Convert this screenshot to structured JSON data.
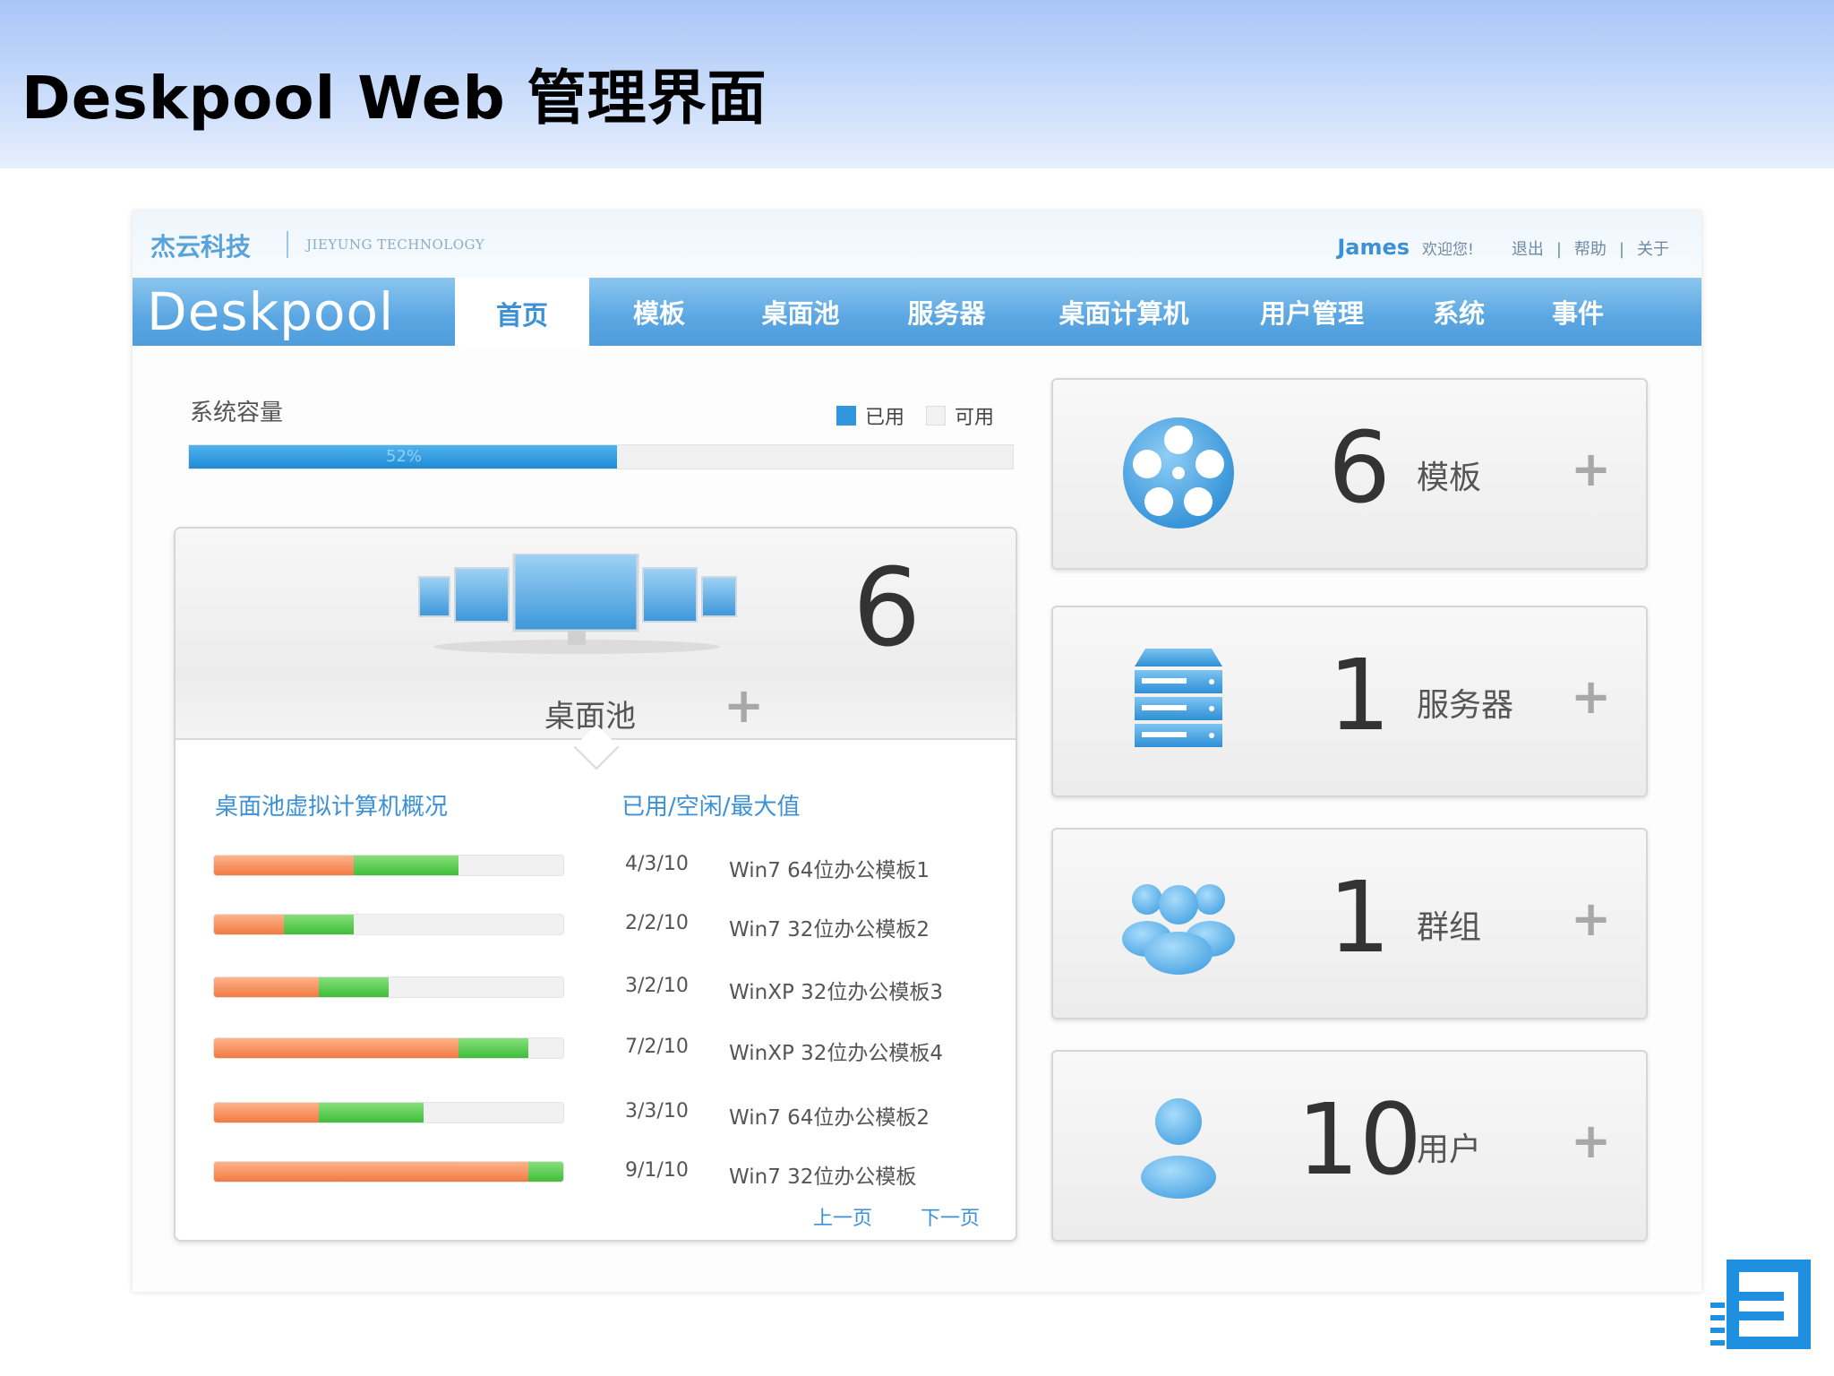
{
  "slide": {
    "title": "Deskpool Web 管理界面"
  },
  "app": {
    "company_cn": "杰云科技",
    "company_en": "JIEYUNG TECHNOLOGY",
    "user": {
      "name": "James",
      "welcome": "欢迎您!",
      "logout": "退出",
      "sep": "|",
      "help": "帮助",
      "about": "关于"
    },
    "brand": "Deskpool",
    "nav": [
      "首页",
      "模板",
      "桌面池",
      "服务器",
      "桌面计算机",
      "用户管理",
      "系统",
      "事件"
    ],
    "active_nav": 0
  },
  "capacity": {
    "label": "系统容量",
    "legend_used": "已用",
    "legend_free": "可用",
    "used_percent": 52,
    "used_text": "52%"
  },
  "pool": {
    "count": "6",
    "name": "桌面池",
    "plus": "+",
    "list_title": "桌面池虚拟计算机概况",
    "list_ratio_title": "已用/空闲/最大值",
    "rows": [
      {
        "ratio": "4/3/10",
        "template": "Win7 64位办公模板1",
        "used": 4,
        "idle": 3,
        "max": 10
      },
      {
        "ratio": "2/2/10",
        "template": "Win7 32位办公模板2",
        "used": 2,
        "idle": 2,
        "max": 10
      },
      {
        "ratio": "3/2/10",
        "template": "WinXP 32位办公模板3",
        "used": 3,
        "idle": 2,
        "max": 10
      },
      {
        "ratio": "7/2/10",
        "template": "WinXP 32位办公模板4",
        "used": 7,
        "idle": 2,
        "max": 10
      },
      {
        "ratio": "3/3/10",
        "template": "Win7 64位办公模板2",
        "used": 3,
        "idle": 3,
        "max": 10
      },
      {
        "ratio": "9/1/10",
        "template": "Win7 32位办公模板",
        "used": 9,
        "idle": 1,
        "max": 10
      }
    ],
    "prev": "上一页",
    "next": "下一页"
  },
  "stats": [
    {
      "count": "6",
      "label": "模板",
      "plus": "+",
      "icon": "film-reel-icon"
    },
    {
      "count": "1",
      "label": "服务器",
      "plus": "+",
      "icon": "server-icon"
    },
    {
      "count": "1",
      "label": "群组",
      "plus": "+",
      "icon": "group-icon"
    },
    {
      "count": "10",
      "label": "用户",
      "plus": "+",
      "icon": "user-icon"
    }
  ],
  "colors": {
    "accent": "#3b90d6",
    "nav": "#5aa6e2",
    "used": "#f07a42",
    "idle": "#3fbd3a",
    "progress": "#1f8bd6"
  }
}
